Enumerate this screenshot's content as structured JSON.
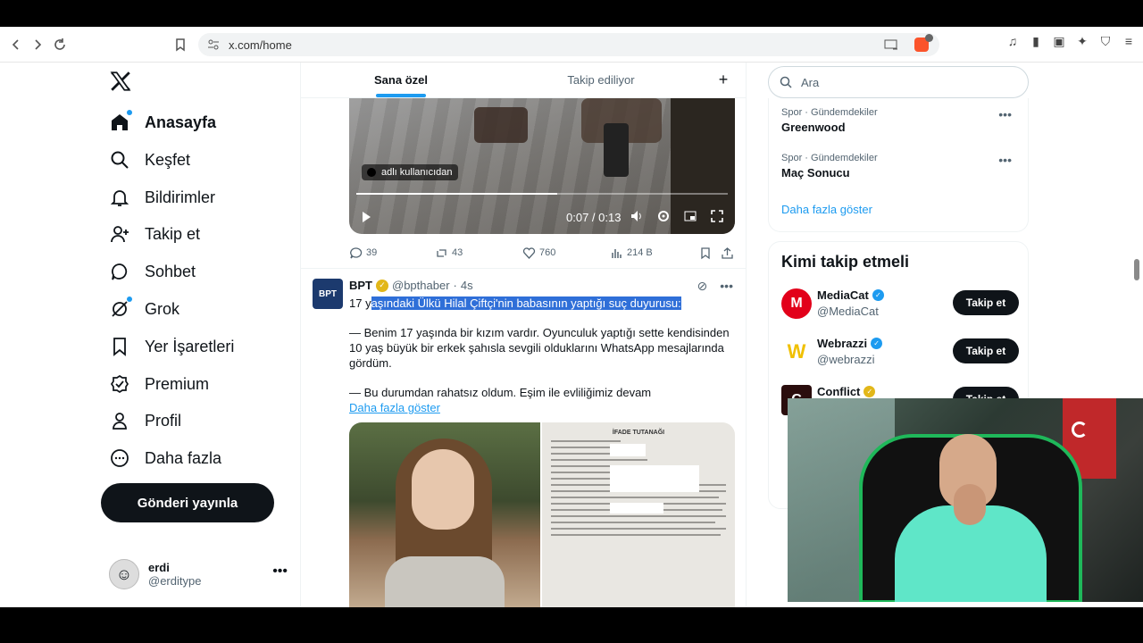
{
  "browser": {
    "url": "x.com/home"
  },
  "sidebar": {
    "items": [
      {
        "label": "Anasayfa",
        "icon": "home-icon"
      },
      {
        "label": "Keşfet",
        "icon": "search-icon"
      },
      {
        "label": "Bildirimler",
        "icon": "bell-icon"
      },
      {
        "label": "Takip et",
        "icon": "person-add-icon"
      },
      {
        "label": "Sohbet",
        "icon": "chat-bubble-icon"
      },
      {
        "label": "Grok",
        "icon": "grok-icon"
      },
      {
        "label": "Yer İşaretleri",
        "icon": "bookmark-icon"
      },
      {
        "label": "Premium",
        "icon": "verified-badge-icon"
      },
      {
        "label": "Profil",
        "icon": "person-icon"
      },
      {
        "label": "Daha fazla",
        "icon": "more-circle-icon"
      }
    ],
    "post_button": "Gönderi yayınla",
    "user": {
      "name": "erdi",
      "handle": "@erditype"
    }
  },
  "tabs": {
    "for_you": "Sana özel",
    "following": "Takip ediliyor",
    "plus": "+"
  },
  "video_tweet": {
    "user_tag": "adlı kullanıcıdan",
    "time": "0:07 / 0:13",
    "progress": 0.54,
    "stats": {
      "replies": "39",
      "reposts": "43",
      "likes": "760",
      "views": "214 B"
    }
  },
  "tweet": {
    "name": "BPT",
    "handle": "@bpthaber",
    "time": "4s",
    "avatar_text": "BPT",
    "line1_plain": "17 y",
    "line1_highlight": "aşındaki Ülkü Hilal Çiftçi'nin babasının yaptığı suç duyurusu:",
    "para2": "— Benim 17 yaşında bir kızım vardır. Oyunculuk yaptığı sette kendisinden 10 yaş büyük bir erkek şahısla sevgili olduklarını WhatsApp mesajlarında gördüm.",
    "para3": "— Bu durumdan rahatsız oldum. Eşim ile evliliğimiz devam",
    "show_more": "Daha fazla göster",
    "doc_title": "İFADE TUTANAĞI"
  },
  "right": {
    "search_placeholder": "Ara",
    "trends": [
      {
        "category": "Spor · Gündemdekiler",
        "title": "Greenwood"
      },
      {
        "category": "Spor · Gündemdekiler",
        "title": "Maç Sonucu"
      }
    ],
    "show_more": "Daha fazla göster",
    "who_to_follow": "Kimi takip etmeli",
    "accounts": [
      {
        "name": "MediaCat",
        "handle": "@MediaCat",
        "button": "Takip et"
      },
      {
        "name": "Webrazzi",
        "handle": "@webrazzi",
        "button": "Takip et"
      },
      {
        "name": "Conflict",
        "handle": "",
        "button": "Takip et"
      }
    ]
  },
  "colors": {
    "accent": "#1d9bf0",
    "text": "#0f1419",
    "muted": "#536471",
    "button_dark": "#0f1419",
    "highlight": "#2f6fd8"
  }
}
